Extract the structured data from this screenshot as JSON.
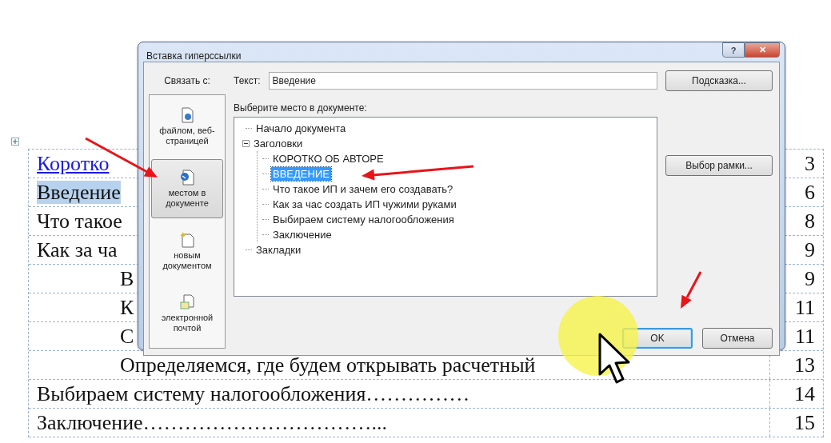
{
  "document": {
    "rows": [
      {
        "kind": "link",
        "text": "Коротко",
        "page": "3",
        "highlighted": false
      },
      {
        "kind": "entry",
        "text": "Введение",
        "page": "6",
        "highlighted": true
      },
      {
        "kind": "entry",
        "text": "Что такое",
        "page": "8",
        "highlighted": false
      },
      {
        "kind": "entry",
        "text": "Как за ча",
        "page": "9",
        "highlighted": false,
        "children": [
          {
            "kind": "entry",
            "text": "В",
            "page": "9",
            "highlighted": false
          },
          {
            "kind": "entry",
            "text": "К",
            "page": "11",
            "highlighted": false
          },
          {
            "kind": "entry",
            "text": "С",
            "page": "11",
            "highlighted": false
          },
          {
            "kind": "entry",
            "text": "Определяемся, где будем открывать расчетный",
            "page": "13",
            "highlighted": false
          }
        ]
      },
      {
        "kind": "entry",
        "text": "Выбираем систему налогообложения……………",
        "page": "14",
        "highlighted": false
      },
      {
        "kind": "entry",
        "text": "Заключение……………………………...",
        "page": "15",
        "highlighted": false
      }
    ]
  },
  "dialog": {
    "title": "Вставка гиперссылки",
    "title_buttons": [
      {
        "kind": "help",
        "label": "?"
      },
      {
        "kind": "close",
        "label": "✕"
      }
    ],
    "link_to": {
      "label": "Связать с:",
      "items": [
        {
          "label": "файлом, веб-страницей",
          "selected": false
        },
        {
          "label": "местом в документе",
          "selected": true
        },
        {
          "label": "новым документом",
          "selected": false
        },
        {
          "label": "электронной почтой",
          "selected": false
        }
      ]
    },
    "text_field": {
      "label": "Текст:",
      "value": "Введение"
    },
    "tip_button": "Подсказка...",
    "place_label": "Выберите место в документе:",
    "tree": [
      {
        "label": "Начало документа",
        "selected": false
      },
      {
        "label": "Заголовки",
        "selected": false,
        "expanded": true,
        "children": [
          {
            "label": "КОРОТКО ОБ АВТОРЕ",
            "selected": false
          },
          {
            "label": "ВВЕДЕНИЕ",
            "selected": true
          },
          {
            "label": "Что такое ИП и зачем его создавать?",
            "selected": false
          },
          {
            "label": "Как за час создать ИП чужими руками",
            "selected": false
          },
          {
            "label": "Выбираем систему налогообложения",
            "selected": false
          },
          {
            "label": "Заключение",
            "selected": false
          }
        ]
      },
      {
        "label": "Закладки",
        "selected": false
      }
    ],
    "frame_button": "Выбор рамки...",
    "buttons": [
      {
        "label": "OK",
        "default": true
      },
      {
        "label": "Отмена",
        "default": false
      }
    ]
  }
}
